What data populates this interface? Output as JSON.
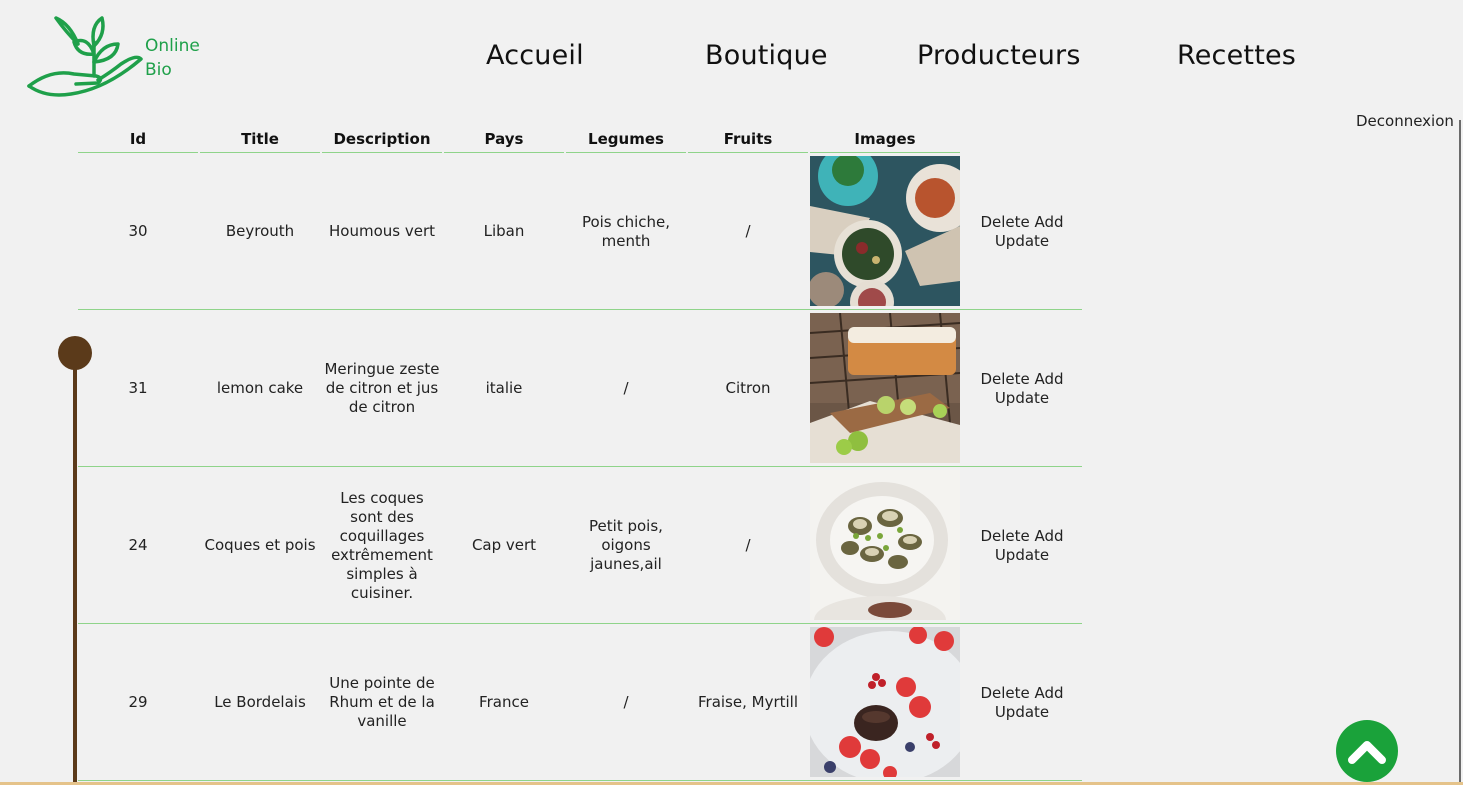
{
  "brand": {
    "line1": "Online",
    "line2": "Bio"
  },
  "nav": [
    "Accueil",
    "Boutique",
    "Producteurs",
    "Recettes"
  ],
  "logout_label": "Deconnexion",
  "table": {
    "headers": [
      "Id",
      "Title",
      "Description",
      "Pays",
      "Legumes",
      "Fruits",
      "Images"
    ],
    "rows": [
      {
        "id": "30",
        "title": "Beyrouth",
        "description": "Houmous vert",
        "pays": "Liban",
        "legumes": "Pois chiche, menth",
        "fruits": "/",
        "image": "mezze-platter-photo",
        "delete": "Delete",
        "add": "Add",
        "update": "Update"
      },
      {
        "id": "31",
        "title": "lemon cake",
        "description": "Meringue zeste de citron et jus de citron",
        "pays": "italie",
        "legumes": "/",
        "fruits": "Citron",
        "image": "lemon-cake-photo",
        "delete": "Delete",
        "add": "Add",
        "update": "Update"
      },
      {
        "id": "24",
        "title": "Coques et pois",
        "description": "Les coques sont des coquillages extrêmement simples à cuisiner.",
        "pays": "Cap vert",
        "legumes": "Petit pois, oigons jaunes,ail",
        "fruits": "/",
        "image": "cockles-peas-photo",
        "delete": "Delete",
        "add": "Add",
        "update": "Update"
      },
      {
        "id": "29",
        "title": "Le Bordelais",
        "description": "Une pointe de Rhum et de la vanille",
        "pays": "France",
        "legumes": "/",
        "fruits": "Fraise, Myrtill",
        "image": "canele-berries-photo",
        "delete": "Delete",
        "add": "Add",
        "update": "Update"
      }
    ]
  },
  "colors": {
    "accent_green": "#1aa23a",
    "logo_green": "#1fa04a",
    "row_line": "#8fd48a",
    "timeline": "#5b3a1a",
    "background": "#f1f1f1"
  },
  "icons": {
    "scroll_top": "chevron-up-icon",
    "logo": "plant-in-hand-icon"
  }
}
